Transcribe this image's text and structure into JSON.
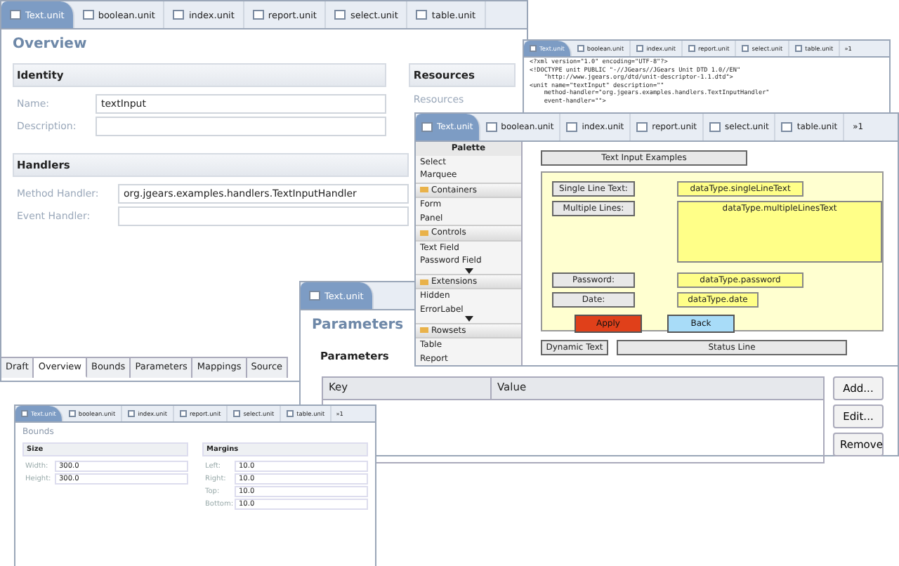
{
  "overview_editor": {
    "tabs": [
      {
        "label": "Text.unit",
        "selected": true
      },
      {
        "label": "boolean.unit",
        "selected": false
      },
      {
        "label": "index.unit",
        "selected": false
      },
      {
        "label": "report.unit",
        "selected": false
      },
      {
        "label": "select.unit",
        "selected": false
      },
      {
        "label": "table.unit",
        "selected": false
      }
    ],
    "title": "Overview",
    "identity": {
      "header": "Identity",
      "fields": [
        {
          "label": "Name:",
          "value": "textInput"
        },
        {
          "label": "Description:"
        }
      ]
    },
    "resources": {
      "header": "Resources",
      "label": "Resources"
    },
    "handlers": {
      "header": "Handlers",
      "fields": [
        {
          "label": "Method Handler:",
          "value": "org.jgears.examples.handlers.TextInputHandler"
        },
        {
          "label": "Event Handler:"
        }
      ]
    },
    "bottom_tabs": [
      {
        "label": "Draft",
        "selected": false
      },
      {
        "label": "Overview",
        "selected": true
      },
      {
        "label": "Bounds",
        "selected": false
      },
      {
        "label": "Parameters",
        "selected": false
      },
      {
        "label": "Mappings",
        "selected": false
      },
      {
        "label": "Source",
        "selected": false
      }
    ]
  },
  "source_editor": {
    "tabs": [
      {
        "label": "Text.unit",
        "selected": true
      },
      {
        "label": "boolean.unit",
        "selected": false
      },
      {
        "label": "index.unit",
        "selected": false
      },
      {
        "label": "report.unit",
        "selected": false
      },
      {
        "label": "select.unit",
        "selected": false
      },
      {
        "label": "table.unit",
        "selected": false
      }
    ],
    "overflow": "»1",
    "lines": [
      "<?xml version=\"1.0\" encoding=\"UTF-8\"?>",
      "<!DOCTYPE unit PUBLIC \"-//JGears//JGears Unit DTD 1.0//EN\"",
      "    \"http://www.jgears.org/dtd/unit-descriptor-1.1.dtd\">",
      "<unit name=\"textInput\" description=\"\"",
      "    method-handler=\"org.jgears.examples.handlers.TextInputHandler\"",
      "    event-handler=\"\">"
    ]
  },
  "designer_editor": {
    "tabs": [
      {
        "label": "Text.unit",
        "selected": true
      },
      {
        "label": "boolean.unit",
        "selected": false
      },
      {
        "label": "index.unit",
        "selected": false
      },
      {
        "label": "report.unit",
        "selected": false
      },
      {
        "label": "select.unit",
        "selected": false
      },
      {
        "label": "table.unit",
        "selected": false
      }
    ],
    "overflow": "»1",
    "palette": {
      "title": "Palette",
      "items": [
        {
          "kind": "tool",
          "label": "Select"
        },
        {
          "kind": "tool",
          "label": "Marquee"
        },
        {
          "kind": "drawer",
          "label": "Containers"
        },
        {
          "kind": "item",
          "label": "Form"
        },
        {
          "kind": "item",
          "label": "Panel"
        },
        {
          "kind": "drawer",
          "label": "Controls"
        },
        {
          "kind": "item",
          "label": "Text Field"
        },
        {
          "kind": "item",
          "label": "Password Field"
        },
        {
          "kind": "more"
        },
        {
          "kind": "drawer",
          "label": "Extensions"
        },
        {
          "kind": "item",
          "label": "Hidden"
        },
        {
          "kind": "item",
          "label": "ErrorLabel"
        },
        {
          "kind": "more"
        },
        {
          "kind": "drawer",
          "label": "Rowsets"
        },
        {
          "kind": "item",
          "label": "Table"
        },
        {
          "kind": "item",
          "label": "Report"
        }
      ]
    },
    "form_title": "Text Input Examples",
    "rows": [
      {
        "label": "Single Line Text:",
        "field": "dataType.singleLineText",
        "kind": "single"
      },
      {
        "label": "Multiple Lines:",
        "field": "dataType.multipleLinesText",
        "kind": "multi"
      },
      {
        "label": "Password:",
        "field": "dataType.password",
        "kind": "single"
      },
      {
        "label": "Date:",
        "field": "dataType.date",
        "kind": "short"
      }
    ],
    "buttons": [
      {
        "label": "Apply",
        "color": "#e0401a"
      },
      {
        "label": "Back",
        "color": "#a8dcf8"
      }
    ],
    "dynamic_text": "Dynamic Text",
    "status_line": "Status Line"
  },
  "parameters_editor": {
    "tabs": [
      {
        "label": "Text.unit",
        "selected": true
      }
    ],
    "title": "Parameters",
    "section": "Parameters",
    "columns": [
      "Key",
      "Value"
    ],
    "buttons": [
      "Add...",
      "Edit...",
      "Remove"
    ]
  },
  "bounds_editor": {
    "tabs": [
      {
        "label": "Text.unit",
        "selected": true
      },
      {
        "label": "boolean.unit",
        "selected": false
      },
      {
        "label": "index.unit",
        "selected": false
      },
      {
        "label": "report.unit",
        "selected": false
      },
      {
        "label": "select.unit",
        "selected": false
      },
      {
        "label": "table.unit",
        "selected": false
      }
    ],
    "overflow": "»1",
    "title": "Bounds",
    "size": {
      "header": "Size",
      "fields": [
        {
          "label": "Width:",
          "value": "300.0"
        },
        {
          "label": "Height:",
          "value": "300.0"
        }
      ]
    },
    "margins": {
      "header": "Margins",
      "fields": [
        {
          "label": "Left:",
          "value": "10.0"
        },
        {
          "label": "Right:",
          "value": "10.0"
        },
        {
          "label": "Top:",
          "value": "10.0"
        },
        {
          "label": "Bottom:",
          "value": "10.0"
        }
      ]
    }
  }
}
